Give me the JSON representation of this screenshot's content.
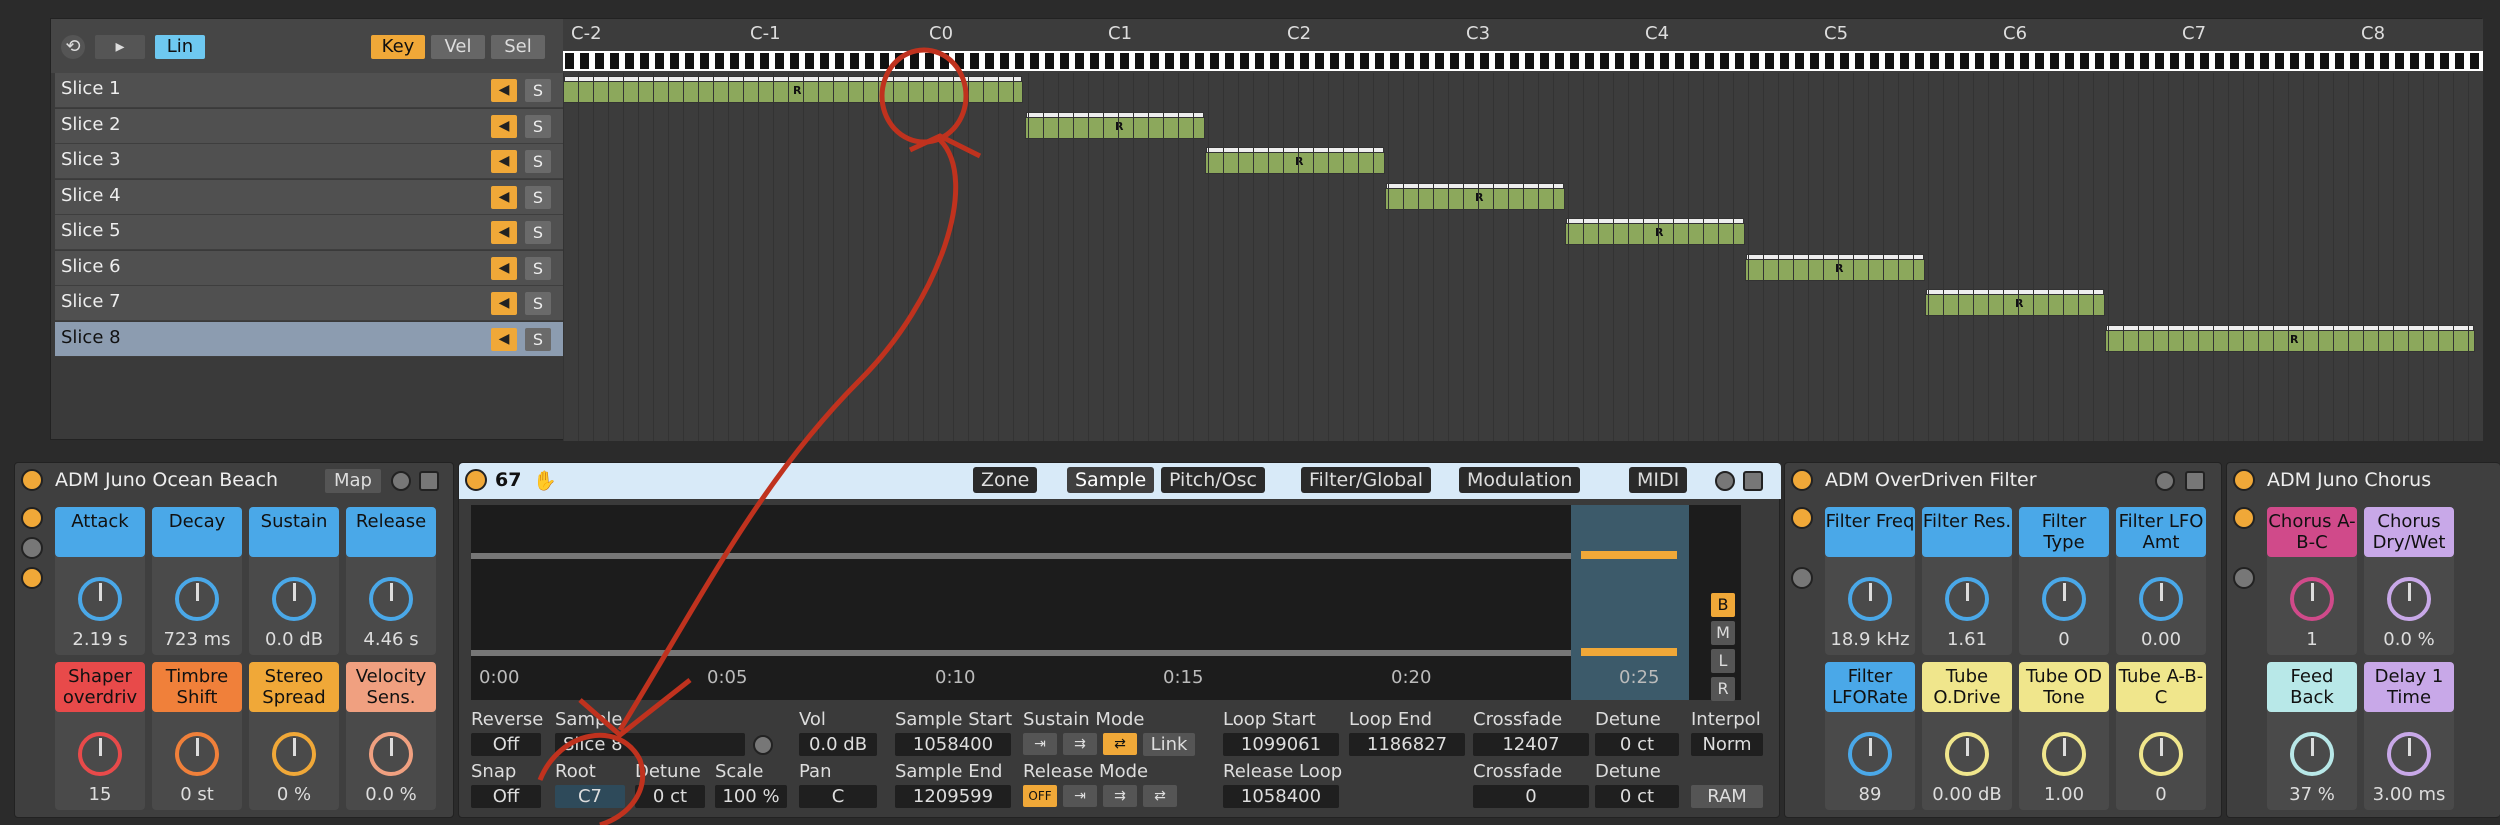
{
  "zone_header": {
    "mode_lin": "Lin",
    "key": "Key",
    "vel": "Vel",
    "sel": "Sel"
  },
  "octaves": [
    "C-2",
    "C-1",
    "C0",
    "C1",
    "C2",
    "C3",
    "C4",
    "C5",
    "C6",
    "C7",
    "C8"
  ],
  "slices": [
    "Slice 1",
    "Slice 2",
    "Slice 3",
    "Slice 4",
    "Slice 5",
    "Slice 6",
    "Slice 7",
    "Slice 8"
  ],
  "solo": "S",
  "zone_marker": "R",
  "juno": {
    "title": "ADM Juno Ocean Beach",
    "map": "Map",
    "params": [
      {
        "label": "Attack",
        "value": "2.19 s",
        "color": "#4aa8e8"
      },
      {
        "label": "Decay",
        "value": "723 ms",
        "color": "#4aa8e8"
      },
      {
        "label": "Sustain",
        "value": "0.0 dB",
        "color": "#4aa8e8"
      },
      {
        "label": "Release",
        "value": "4.46 s",
        "color": "#4aa8e8"
      },
      {
        "label": "Shaper overdriv",
        "value": "15",
        "color": "#e84a4a"
      },
      {
        "label": "Timbre Shift",
        "value": "0 st",
        "color": "#f0803a"
      },
      {
        "label": "Stereo Spread",
        "value": "0 %",
        "color": "#f0a838"
      },
      {
        "label": "Velocity Sens.",
        "value": "0.0 %",
        "color": "#f0a080"
      }
    ]
  },
  "sampler": {
    "num": "67",
    "tabs": [
      "Zone",
      "Sample",
      "Pitch/Osc",
      "Filter/Global",
      "Modulation",
      "MIDI"
    ],
    "time_labels": [
      "0:00",
      "0:05",
      "0:10",
      "0:15",
      "0:20",
      "0:25"
    ],
    "side_buttons": [
      "B",
      "M",
      "L",
      "R"
    ],
    "reverse_label": "Reverse",
    "reverse_value": "Off",
    "sample_label": "Sample",
    "sample_value": "Slice 8",
    "vol_label": "Vol",
    "vol_value": "0.0 dB",
    "sample_start_label": "Sample Start",
    "sample_start": "1058400",
    "sustain_mode_label": "Sustain Mode",
    "link": "Link",
    "loop_start_label": "Loop Start",
    "loop_start": "1099061",
    "loop_end_label": "Loop End",
    "loop_end": "1186827",
    "crossfade_label": "Crossfade",
    "crossfade1": "12407",
    "crossfade2": "0",
    "detune_label": "Detune",
    "detune1": "0 ct",
    "detune2": "0 ct",
    "interpol_label": "Interpol",
    "interpol": "Norm",
    "snap_label": "Snap",
    "snap_value": "Off",
    "root_label": "Root",
    "root_value": "C7",
    "detune_s_label": "Detune",
    "detune_s": "0 ct",
    "scale_label": "Scale",
    "scale_value": "100 %",
    "pan_label": "Pan",
    "pan_value": "C",
    "sample_end_label": "Sample End",
    "sample_end": "1209599",
    "release_mode_label": "Release Mode",
    "release_off": "OFF",
    "release_loop_label": "Release Loop",
    "release_loop": "1058400",
    "ram": "RAM"
  },
  "filter": {
    "title": "ADM OverDriven Filter",
    "params": [
      {
        "label": "Filter Freq",
        "value": "18.9 kHz",
        "color": "#4aa8e8"
      },
      {
        "label": "Filter Res.",
        "value": "1.61",
        "color": "#4aa8e8"
      },
      {
        "label": "Filter Type",
        "value": "0",
        "color": "#4aa8e8"
      },
      {
        "label": "Filter LFO Amt",
        "value": "0.00",
        "color": "#4aa8e8"
      },
      {
        "label": "Filter LFORate",
        "value": "89",
        "color": "#4aa8e8"
      },
      {
        "label": "Tube O.Drive",
        "value": "0.00 dB",
        "color": "#f0e68c"
      },
      {
        "label": "Tube OD Tone",
        "value": "1.00",
        "color": "#f0e68c"
      },
      {
        "label": "Tube A-B-C",
        "value": "0",
        "color": "#f0e68c"
      }
    ]
  },
  "chorus": {
    "title": "ADM  Juno Chorus",
    "params": [
      {
        "label": "Chorus A-B-C",
        "value": "1",
        "color": "#d04a8a"
      },
      {
        "label": "Chorus Dry/Wet",
        "value": "0.0 %",
        "color": "#c8a8e8"
      },
      {
        "label": "Feed Back",
        "value": "37 %",
        "color": "#b8e8e8"
      },
      {
        "label": "Delay 1 Time",
        "value": "3.00 ms",
        "color": "#c8a8e8"
      }
    ]
  }
}
